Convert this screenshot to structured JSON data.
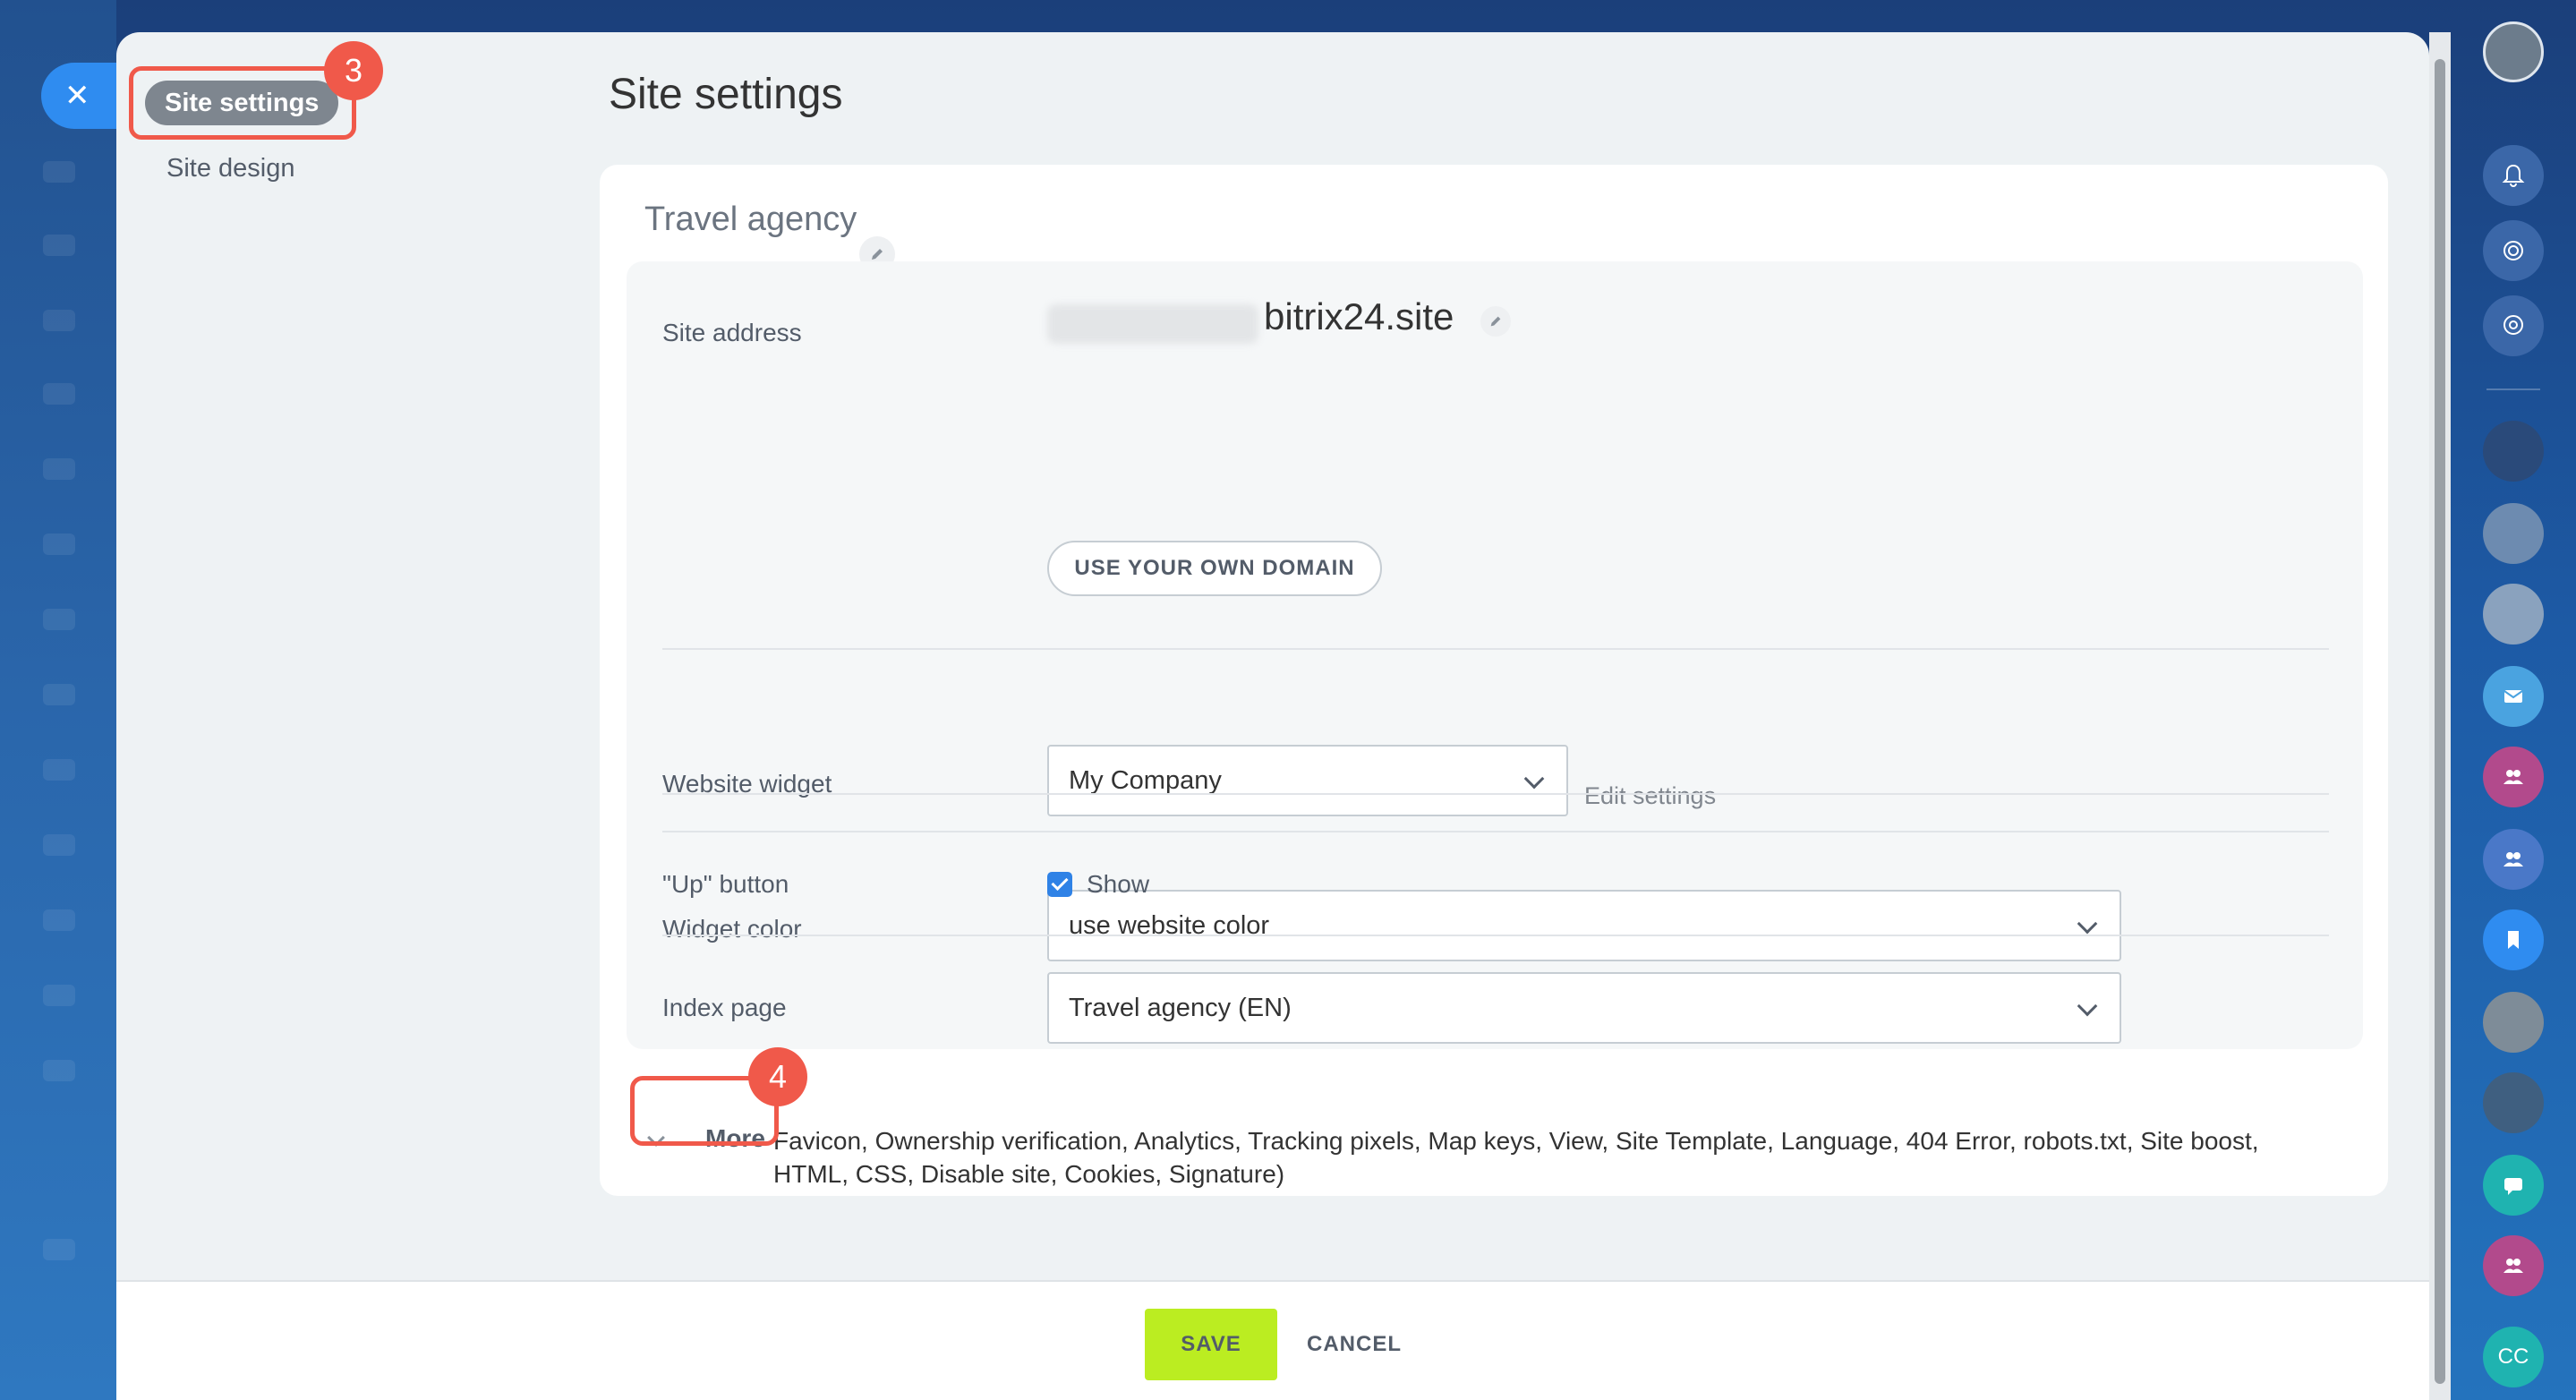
{
  "nav": {
    "active_label": "Site settings",
    "items": [
      {
        "label": "Site design"
      }
    ]
  },
  "callouts": {
    "first": "3",
    "second": "4"
  },
  "page": {
    "title": "Site settings"
  },
  "card": {
    "title": "Travel agency",
    "site_address": {
      "label": "Site address",
      "domain_suffix": "bitrix24.site",
      "own_domain_button": "USE YOUR OWN DOMAIN"
    },
    "website_widget": {
      "label": "Website widget",
      "selected": "My Company",
      "edit_link": "Edit settings"
    },
    "widget_color": {
      "label": "Widget color",
      "selected": "use website color"
    },
    "up_button": {
      "label": "\"Up\" button",
      "checkbox_label": "Show",
      "checked": true
    },
    "index_page": {
      "label": "Index page",
      "selected": "Travel agency (EN)"
    },
    "more": {
      "toggle_label": "More",
      "items_text": "Favicon,  Ownership verification,  Analytics,  Tracking pixels,  Map keys,  View,  Site Template,  Language,  404 Error,  robots.txt,  Site boost,  HTML,  CSS,  Disable site,  Cookies,  Signature)"
    }
  },
  "footer": {
    "save_label": "SAVE",
    "cancel_label": "CANCEL"
  },
  "rail": {
    "items": [
      {
        "icon": "user-avatar"
      },
      {
        "icon": "bell-icon"
      },
      {
        "icon": "copilot-icon"
      },
      {
        "icon": "search-chat-icon"
      },
      {
        "icon": "contact-avatar"
      },
      {
        "icon": "contact-avatar"
      },
      {
        "icon": "group-avatar"
      },
      {
        "icon": "mail-icon"
      },
      {
        "icon": "group-chat-icon"
      },
      {
        "icon": "group-chat-icon"
      },
      {
        "icon": "bookmark-icon"
      },
      {
        "icon": "contact-avatar"
      },
      {
        "icon": "contact-avatar"
      },
      {
        "icon": "chat-icon"
      },
      {
        "icon": "group-chat-icon"
      },
      {
        "initials": "CC"
      }
    ]
  },
  "colors": {
    "accent_blue": "#2f8cf0",
    "save_green": "#bbed21",
    "callout_red": "#f0594a"
  }
}
